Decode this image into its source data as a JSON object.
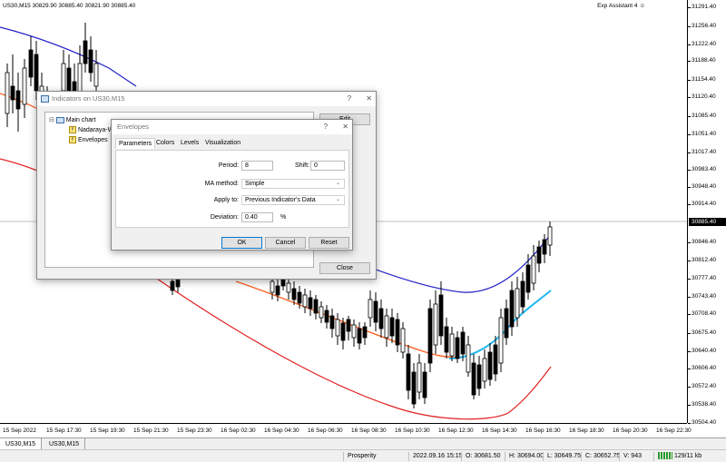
{
  "chart": {
    "header": "US30,M15  30829.90 30885.40 30821.90 30885.40",
    "expert": "Exp Assistant 4",
    "expert_icon": "smiley-icon",
    "price_labels": [
      "31291.40",
      "31256.40",
      "31222.40",
      "31188.40",
      "31154.40",
      "31120.40",
      "31085.40",
      "31051.40",
      "31017.40",
      "30983.40",
      "30948.40",
      "30914.40",
      "30846.40",
      "30812.40",
      "30777.40",
      "30743.40",
      "30708.40",
      "30675.40",
      "30640.40",
      "30606.40",
      "30572.40",
      "30538.40",
      "30504.40"
    ],
    "current_price": "30885.40",
    "time_labels": [
      "15 Sep 2022",
      "15 Sep 17:30",
      "15 Sep 19:30",
      "15 Sep 21:30",
      "15 Sep 23:30",
      "16 Sep 02:30",
      "16 Sep 04:30",
      "16 Sep 06:30",
      "16 Sep 08:30",
      "16 Sep 10:30",
      "16 Sep 12:30",
      "16 Sep 14:30",
      "16 Sep 16:30",
      "16 Sep 18:30",
      "16 Sep 20:30",
      "16 Sep 22:30"
    ],
    "colors": {
      "upper_band": "#1f1fc8",
      "lower_band": "#e32020",
      "mid_line": "#ff6020",
      "mid_line_up": "#20b8f0",
      "candle": "#000000"
    }
  },
  "tabs": [
    "US30,M15",
    "US30,M15"
  ],
  "status": {
    "profile": "Prosperity",
    "datetime": "2022.09.16 15:15",
    "open": "O: 30681.50",
    "high": "H: 30694.00",
    "low": "L: 30649.75",
    "close": "C: 30652.75",
    "volume": "V: 943",
    "traffic": "129/11 kb"
  },
  "indicators_dialog": {
    "title": "Indicators on US30,M15",
    "help": "?",
    "close": "✕",
    "tree_root": "Main chart",
    "tree_items": [
      "Nadaraya-W",
      "Envelopes"
    ],
    "edit_button": "Edit",
    "close_button": "Close"
  },
  "envelopes_dialog": {
    "title": "Envelopes",
    "help": "?",
    "close": "✕",
    "tabs": [
      "Parameters",
      "Colors",
      "Levels",
      "Visualization"
    ],
    "period_label": "Period:",
    "period_value": "8",
    "shift_label": "Shift:",
    "shift_value": "0",
    "ma_method_label": "MA method:",
    "ma_method_value": "Simple",
    "apply_to_label": "Apply to:",
    "apply_to_value": "Previous Indicator's Data",
    "deviation_label": "Deviation:",
    "deviation_value": "0.40",
    "deviation_unit": "%",
    "ok": "OK",
    "cancel": "Cancel",
    "reset": "Reset"
  }
}
